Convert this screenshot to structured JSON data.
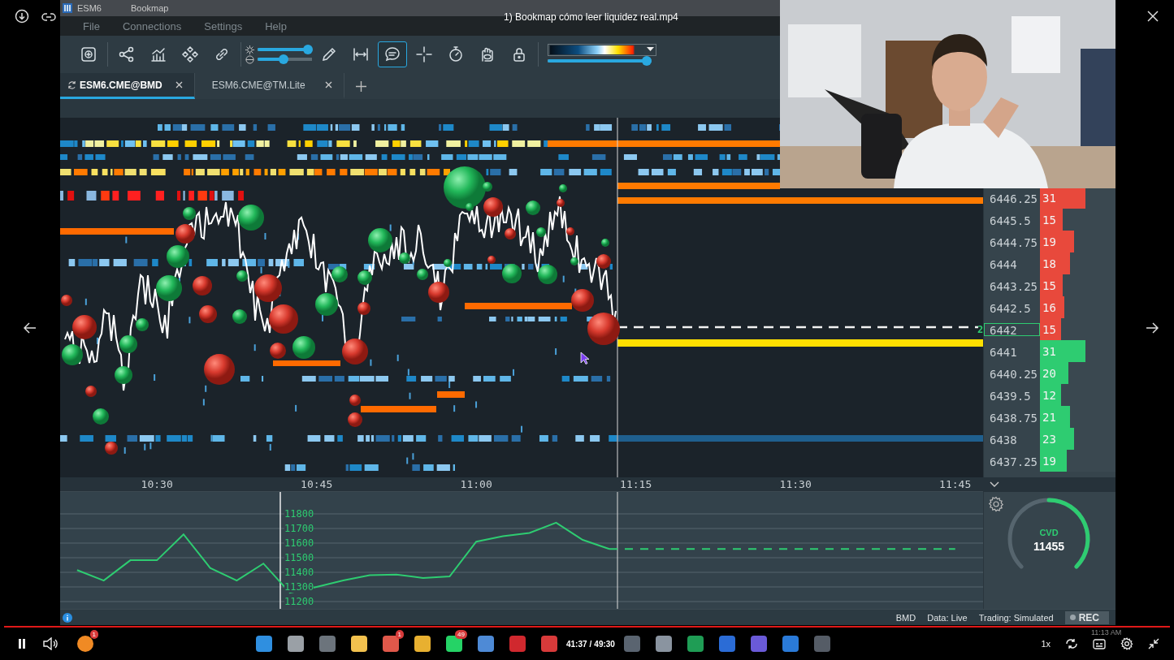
{
  "window": {
    "symbol": "ESM6",
    "app": "Bookmap"
  },
  "video_title": "1) Bookmap cómo leer liquidez real.mp4",
  "menu": [
    "File",
    "Connections",
    "Settings",
    "Help"
  ],
  "toolbar": {
    "tools": [
      {
        "kind": "add-chart",
        "selected": false
      },
      {
        "kind": "share",
        "selected": false
      },
      {
        "kind": "bar-chart",
        "selected": false
      },
      {
        "kind": "diamonds",
        "selected": false
      },
      {
        "kind": "link",
        "selected": false
      },
      {
        "kind": "pencil",
        "selected": false
      },
      {
        "kind": "measure",
        "selected": false
      },
      {
        "kind": "comment",
        "selected": true
      },
      {
        "kind": "crosshair",
        "selected": false
      },
      {
        "kind": "stopwatch",
        "selected": false
      },
      {
        "kind": "eye-hand",
        "selected": false
      },
      {
        "kind": "lock",
        "selected": false
      }
    ],
    "brightness": {
      "level": 0.93
    },
    "contrast": {
      "level": 0.48
    },
    "palette": {
      "level": 0.95
    }
  },
  "tabs": [
    {
      "label": "ESM6.CME@BMD",
      "selected": true
    },
    {
      "label": "ESM6.CME@TM.Lite",
      "selected": false
    }
  ],
  "ladder": {
    "current_marker": "2",
    "rows": [
      {
        "price": "6446.25",
        "size": "31",
        "kind": "ask",
        "level": 0.6,
        "current": false
      },
      {
        "price": "6445.5",
        "size": "15",
        "kind": "ask",
        "level": 0.3,
        "current": false
      },
      {
        "price": "6444.75",
        "size": "19",
        "kind": "ask",
        "level": 0.45,
        "current": false
      },
      {
        "price": "6444",
        "size": "18",
        "kind": "ask",
        "level": 0.4,
        "current": false
      },
      {
        "price": "6443.25",
        "size": "15",
        "kind": "ask",
        "level": 0.3,
        "current": false
      },
      {
        "price": "6442.5",
        "size": "16",
        "kind": "ask",
        "level": 0.32,
        "current": false
      },
      {
        "price": "6442",
        "size": "15",
        "kind": "ask",
        "level": 0.28,
        "current": true
      },
      {
        "price": "6441",
        "size": "31",
        "kind": "bid",
        "level": 0.6,
        "current": false
      },
      {
        "price": "6440.25",
        "size": "20",
        "kind": "bid",
        "level": 0.38,
        "current": false
      },
      {
        "price": "6439.5",
        "size": "12",
        "kind": "bid",
        "level": 0.28,
        "current": false
      },
      {
        "price": "6438.75",
        "size": "21",
        "kind": "bid",
        "level": 0.4,
        "current": false
      },
      {
        "price": "6438",
        "size": "23",
        "kind": "bid",
        "level": 0.45,
        "current": false
      },
      {
        "price": "6437.25",
        "size": "19",
        "kind": "bid",
        "level": 0.36,
        "current": false
      }
    ]
  },
  "cvd_chart": {
    "chart_data": {
      "type": "line",
      "categories": [
        null,
        null,
        null,
        null,
        "10:30",
        null,
        null,
        null,
        null,
        null,
        "10:45",
        null,
        null,
        null,
        null,
        null,
        "11:00",
        null,
        null,
        null,
        null,
        null,
        "11:15",
        null,
        null,
        null,
        null,
        null,
        "11:30",
        null,
        null,
        null,
        null,
        null,
        "11:45"
      ],
      "series": [
        {
          "color": "#2ecc71",
          "values": [
            null,
            11415,
            11344,
            11483,
            11483,
            11660,
            11430,
            11344,
            11460,
            11260,
            11300,
            11344,
            11380,
            11385,
            11361,
            11372,
            11610,
            11648,
            11670,
            11740,
            11622,
            11560,
            null,
            null,
            null,
            null,
            null,
            null,
            null,
            null,
            null,
            null,
            null,
            null,
            null
          ]
        },
        {
          "color": "#2ecc71",
          "line_style": "dashed",
          "values": [
            null,
            null,
            null,
            null,
            null,
            null,
            null,
            null,
            null,
            null,
            null,
            null,
            null,
            null,
            null,
            null,
            null,
            null,
            null,
            null,
            null,
            11560,
            11560,
            11560,
            11560,
            11560,
            11560,
            11560,
            11560,
            11560,
            11560,
            11560,
            11560,
            11560,
            11560
          ]
        }
      ],
      "grid": true,
      "ylim": [
        11150,
        11950
      ],
      "yticks": [
        11200,
        11300,
        11400,
        11500,
        11600,
        11700,
        11800
      ]
    }
  },
  "cvd_gauge": {
    "label": "CVD",
    "value": "11455",
    "level": 1.0
  },
  "status_bar": {
    "connection": "BMD",
    "data": "Data: Live",
    "trading": "Trading: Simulated",
    "rec": "REC"
  },
  "player": {
    "time_current": "41:37",
    "separator": "/",
    "time_total": "49:30",
    "speed": "1x"
  },
  "taskbar": {
    "clock": "11:13 AM",
    "apps": [
      {
        "color": "#2f8fe0"
      },
      {
        "color": "#9aa0a6"
      },
      {
        "color": "#6c747c"
      },
      {
        "color": "#f2c14e"
      },
      {
        "color": "#e0584a",
        "badge": "1"
      },
      {
        "color": "#e8b030"
      },
      {
        "color": "#25d366",
        "badge": "49"
      },
      {
        "color": "#4e8ad6"
      },
      {
        "color": "#d0282e"
      },
      {
        "color": "#d83a3a"
      },
      {
        "color": "#5a6470"
      },
      {
        "color": "#8a94a0"
      },
      {
        "color": "#1f9d55"
      },
      {
        "color": "#2b6cd6"
      },
      {
        "color": "#6a5ad8"
      },
      {
        "color": "#2a7ad8"
      },
      {
        "color": "#555c66"
      }
    ],
    "first_app": {
      "color": "#f08a24",
      "badge": "1"
    }
  }
}
